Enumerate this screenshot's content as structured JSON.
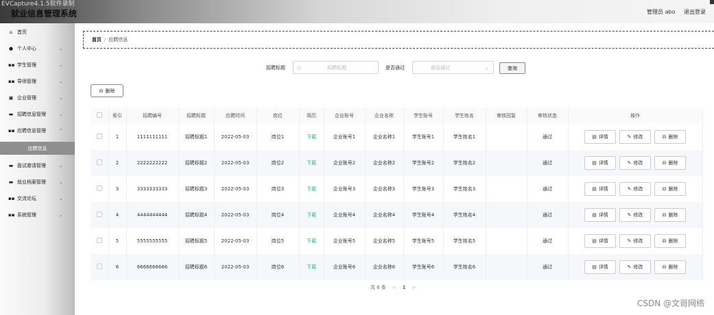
{
  "window": {
    "capture_title": "EVCapture4.1.5软件录制"
  },
  "header": {
    "title": "就业信息管理系统",
    "user_label": "管理员 abo",
    "logout_label": "退出登录"
  },
  "sidebar": {
    "items": [
      {
        "icon": "home-icon",
        "label": "首页"
      },
      {
        "icon": "user-icon",
        "label": "个人中心"
      },
      {
        "icon": "grid-icon",
        "label": "学生管理"
      },
      {
        "icon": "grid-icon",
        "label": "导师管理"
      },
      {
        "icon": "building-icon",
        "label": "企业管理"
      },
      {
        "icon": "folder-icon",
        "label": "招聘信息管理"
      },
      {
        "icon": "grid-icon",
        "label": "应聘信息管理"
      },
      {
        "label": "应聘信息"
      },
      {
        "icon": "folder-icon",
        "label": "面试邀请管理"
      },
      {
        "icon": "folder-icon",
        "label": "就业档案管理"
      },
      {
        "icon": "grid-icon",
        "label": "交流论坛"
      },
      {
        "icon": "grid-icon",
        "label": "系统管理"
      }
    ]
  },
  "breadcrumb": {
    "home": "首页",
    "separator": "/",
    "current": "应聘信息"
  },
  "search": {
    "title_label": "招聘标题",
    "title_placeholder": "招聘标题",
    "status_label": "是否通过",
    "status_placeholder": "是否通过",
    "query_button": "查询"
  },
  "toolbar": {
    "delete_label": "删除"
  },
  "table": {
    "headers": [
      "",
      "索引",
      "招聘编号",
      "招聘标题",
      "应聘时间",
      "岗位",
      "简历",
      "企业账号",
      "企业名称",
      "学生账号",
      "学生姓名",
      "审核回复",
      "审核状态",
      "操作"
    ],
    "rows": [
      {
        "index": "1",
        "no": "1111111111",
        "title": "招聘标题1",
        "time": "2022-05-03",
        "post": "岗位1",
        "resume": "下载",
        "ent_acc": "企业账号1",
        "ent_name": "企业名称1",
        "stu_acc": "学生账号1",
        "stu_name": "学生姓名1",
        "reply": "",
        "status": "通过"
      },
      {
        "index": "2",
        "no": "2222222222",
        "title": "招聘标题2",
        "time": "2022-05-03",
        "post": "岗位2",
        "resume": "下载",
        "ent_acc": "企业账号2",
        "ent_name": "企业名称2",
        "stu_acc": "学生账号2",
        "stu_name": "学生姓名2",
        "reply": "",
        "status": "通过"
      },
      {
        "index": "3",
        "no": "3333333333",
        "title": "招聘标题3",
        "time": "2022-05-03",
        "post": "岗位3",
        "resume": "下载",
        "ent_acc": "企业账号3",
        "ent_name": "企业名称3",
        "stu_acc": "学生账号3",
        "stu_name": "学生姓名3",
        "reply": "",
        "status": "通过"
      },
      {
        "index": "4",
        "no": "4444444444",
        "title": "招聘标题4",
        "time": "2022-05-03",
        "post": "岗位4",
        "resume": "下载",
        "ent_acc": "企业账号4",
        "ent_name": "企业名称4",
        "stu_acc": "学生账号4",
        "stu_name": "学生姓名4",
        "reply": "",
        "status": "通过"
      },
      {
        "index": "5",
        "no": "5555555555",
        "title": "招聘标题5",
        "time": "2022-05-03",
        "post": "岗位5",
        "resume": "下载",
        "ent_acc": "企业账号5",
        "ent_name": "企业名称5",
        "stu_acc": "学生账号5",
        "stu_name": "学生姓名5",
        "reply": "",
        "status": "通过"
      },
      {
        "index": "6",
        "no": "6666666666",
        "title": "招聘标题6",
        "time": "2022-05-03",
        "post": "岗位6",
        "resume": "下载",
        "ent_acc": "企业账号6",
        "ent_name": "企业名称6",
        "stu_acc": "学生账号6",
        "stu_name": "学生姓名6",
        "reply": "",
        "status": "通过"
      }
    ],
    "actions": {
      "detail": "详情",
      "edit": "修改",
      "delete": "删除"
    }
  },
  "pagination": {
    "total": "共 6 条",
    "prev": "<",
    "page": "1",
    "next": ">"
  },
  "watermark": "CSDN @文哥网络",
  "colors": {
    "resume_link": "#2bb673",
    "active_page": "#2c7be5",
    "sidebar_active": "#8f8f8f"
  }
}
